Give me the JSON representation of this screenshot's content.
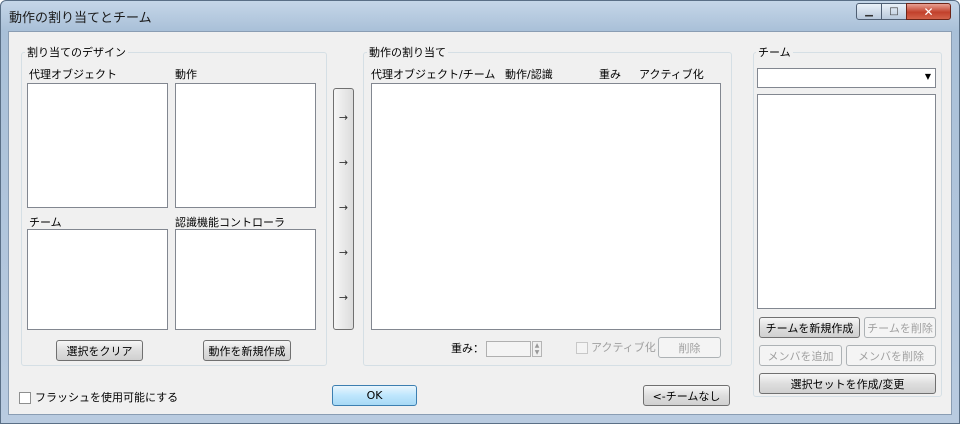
{
  "window": {
    "title": "動作の割り当てとチーム",
    "minimize_glyph": "▁",
    "maximize_glyph": "□",
    "close_glyph": "✕"
  },
  "design": {
    "group_label": "割り当てのデザイン",
    "proxy_label": "代理オブジェクト",
    "motion_label": "動作",
    "team_label": "チーム",
    "controller_label": "認識機能コントローラ",
    "clear_selection": "選択をクリア",
    "new_motion": "動作を新規作成"
  },
  "assign_arrows": [
    "→",
    "→",
    "→",
    "→",
    "→"
  ],
  "assignment": {
    "group_label": "動作の割り当て",
    "columns": [
      "代理オブジェクト/チーム",
      "動作/認識",
      "重み",
      "アクティブ化"
    ],
    "weight_label": "重み：",
    "weight_value": "",
    "activate_label": "アクティブ化",
    "activate_checked": false,
    "delete": "削除"
  },
  "team": {
    "group_label": "チーム",
    "selected": "",
    "new_team": "チームを新規作成",
    "delete_team": "チームを削除",
    "add_member": "メンバを追加",
    "remove_member": "メンバを削除",
    "selection_set": "選択セットを作成/変更"
  },
  "footer": {
    "flash_label": "フラッシュを使用可能にする",
    "flash_checked": false,
    "ok": "OK",
    "no_team": "<-チームなし"
  },
  "colors": {
    "title_gradient_top": "#c5d6e8",
    "client_bg": "#f0f0f0",
    "default_button_border": "#3c7fb1",
    "close_button": "#c2412c"
  }
}
